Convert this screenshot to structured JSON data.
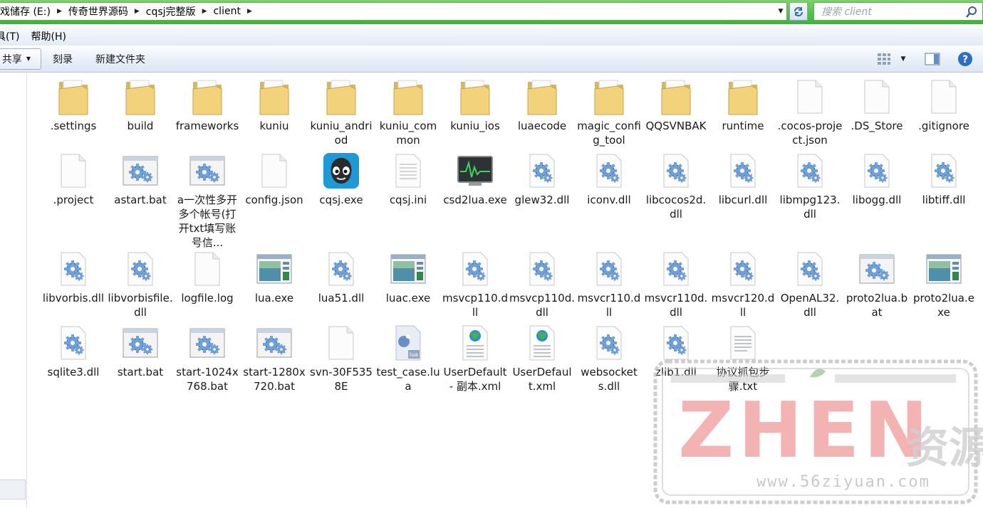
{
  "address": {
    "crumbs": [
      "戏储存 (E:)",
      "传奇世界源码",
      "cqsj完整版",
      "client"
    ],
    "search_placeholder": "搜索 client"
  },
  "menu": [
    "具(T)",
    "帮助(H)"
  ],
  "toolbar": {
    "share_label": "共享",
    "burn_label": "刻录",
    "new_folder_label": "新建文件夹"
  },
  "files": [
    {
      "name": ".settings",
      "icon": "folder-icon"
    },
    {
      "name": "build",
      "icon": "folder-icon"
    },
    {
      "name": "frameworks",
      "icon": "folder-icon"
    },
    {
      "name": "kuniu",
      "icon": "folder-icon"
    },
    {
      "name": "kuniu_andriod",
      "icon": "folder-icon"
    },
    {
      "name": "kuniu_common",
      "icon": "folder-icon"
    },
    {
      "name": "kuniu_ios",
      "icon": "folder-icon"
    },
    {
      "name": "luaecode",
      "icon": "folder-icon"
    },
    {
      "name": "magic_config_tool",
      "icon": "folder-icon"
    },
    {
      "name": "QQSVNBAK",
      "icon": "folder-icon"
    },
    {
      "name": "runtime",
      "icon": "folder-icon"
    },
    {
      "name": ".cocos-project.json",
      "icon": "file-icon"
    },
    {
      "name": ".DS_Store",
      "icon": "file-icon"
    },
    {
      "name": ".gitignore",
      "icon": "file-icon"
    },
    {
      "name": ".project",
      "icon": "file-icon"
    },
    {
      "name": "astart.bat",
      "icon": "bat-icon"
    },
    {
      "name": "a一次性多开多个帐号(打开txt填写账号信...",
      "icon": "bat-icon"
    },
    {
      "name": "config.json",
      "icon": "file-icon"
    },
    {
      "name": "cqsj.exe",
      "icon": "cocos-app-icon"
    },
    {
      "name": "cqsj.ini",
      "icon": "ini-icon"
    },
    {
      "name": "csd2lua.exe",
      "icon": "monitor-app-icon"
    },
    {
      "name": "glew32.dll",
      "icon": "dll-icon"
    },
    {
      "name": "iconv.dll",
      "icon": "dll-icon"
    },
    {
      "name": "libcocos2d.dll",
      "icon": "dll-icon"
    },
    {
      "name": "libcurl.dll",
      "icon": "dll-icon"
    },
    {
      "name": "libmpg123.dll",
      "icon": "dll-icon"
    },
    {
      "name": "libogg.dll",
      "icon": "dll-icon"
    },
    {
      "name": "libtiff.dll",
      "icon": "dll-icon"
    },
    {
      "name": "libvorbis.dll",
      "icon": "dll-icon"
    },
    {
      "name": "libvorbisfile.dll",
      "icon": "dll-icon"
    },
    {
      "name": "logfile.log",
      "icon": "file-icon"
    },
    {
      "name": "lua.exe",
      "icon": "exe-icon"
    },
    {
      "name": "lua51.dll",
      "icon": "dll-icon"
    },
    {
      "name": "luac.exe",
      "icon": "exe-icon"
    },
    {
      "name": "msvcp110.dll",
      "icon": "dll-icon"
    },
    {
      "name": "msvcp110d.dll",
      "icon": "dll-icon"
    },
    {
      "name": "msvcr110.dll",
      "icon": "dll-icon"
    },
    {
      "name": "msvcr110d.dll",
      "icon": "dll-icon"
    },
    {
      "name": "msvcr120.dll",
      "icon": "dll-icon"
    },
    {
      "name": "OpenAL32.dll",
      "icon": "dll-icon"
    },
    {
      "name": "proto2lua.bat",
      "icon": "bat-icon"
    },
    {
      "name": "proto2lua.exe",
      "icon": "exe-icon"
    },
    {
      "name": "sqlite3.dll",
      "icon": "dll-icon"
    },
    {
      "name": "start.bat",
      "icon": "bat-icon"
    },
    {
      "name": "start-1024x768.bat",
      "icon": "bat-icon"
    },
    {
      "name": "start-1280x720.bat",
      "icon": "bat-icon"
    },
    {
      "name": "svn-30F5358E",
      "icon": "file-icon"
    },
    {
      "name": "test_case.lua",
      "icon": "lua-icon"
    },
    {
      "name": "UserDefault - 副本.xml",
      "icon": "xml-icon"
    },
    {
      "name": "UserDefault.xml",
      "icon": "xml-icon"
    },
    {
      "name": "websockets.dll",
      "icon": "dll-icon"
    },
    {
      "name": "zlib1.dll",
      "icon": "dll-icon"
    },
    {
      "name": "协议抓包步骤.txt",
      "icon": "txt-icon"
    }
  ],
  "watermark": {
    "text": "ZHEN资源",
    "url": "www.56ziyuan.com"
  }
}
